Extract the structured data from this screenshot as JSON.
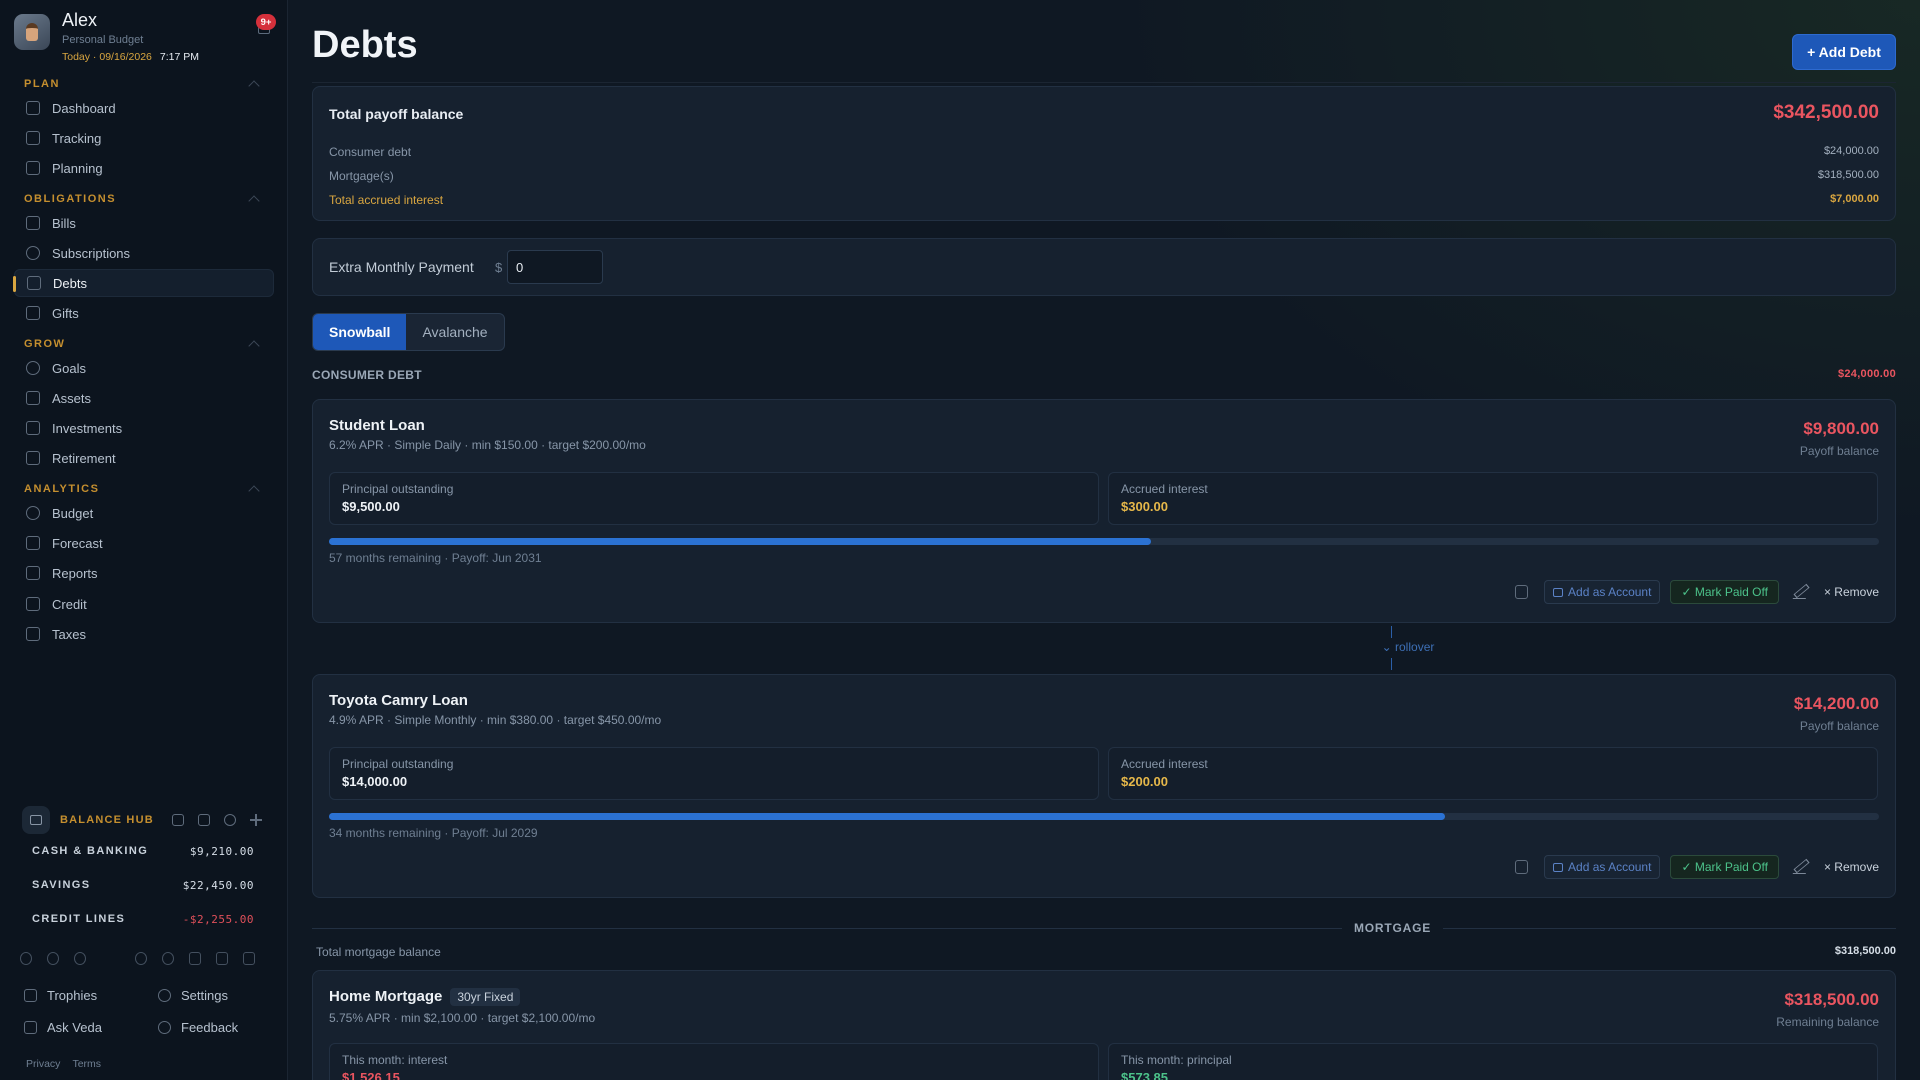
{
  "profile": {
    "name": "Alex",
    "subtitle": "Personal Budget",
    "date": "Today · 09/16/2026",
    "time": "7:17 PM",
    "notifications": "9+"
  },
  "nav": {
    "plan": {
      "title": "PLAN",
      "items": [
        "Dashboard",
        "Tracking",
        "Planning"
      ]
    },
    "obligations": {
      "title": "OBLIGATIONS",
      "items": [
        "Bills",
        "Subscriptions",
        "Debts",
        "Gifts"
      ]
    },
    "grow": {
      "title": "GROW",
      "items": [
        "Goals",
        "Assets",
        "Investments",
        "Retirement"
      ]
    },
    "analytics": {
      "title": "ANALYTICS",
      "items": [
        "Budget",
        "Forecast",
        "Reports",
        "Credit",
        "Taxes"
      ]
    },
    "active": "Debts"
  },
  "hub": {
    "title": "BALANCE HUB",
    "rows": [
      {
        "label": "CASH & BANKING",
        "value": "$9,210.00"
      },
      {
        "label": "SAVINGS",
        "value": "$22,450.00"
      },
      {
        "label": "CREDIT LINES",
        "value": "-$2,255.00"
      }
    ]
  },
  "footer": {
    "trophies": "Trophies",
    "settings": "Settings",
    "ask": "Ask Veda",
    "feedback": "Feedback",
    "privacy": "Privacy",
    "terms": "Terms"
  },
  "page": {
    "title": "Debts",
    "add_button": "+ Add Debt"
  },
  "totals": {
    "title": "Total payoff balance",
    "amount": "$342,500.00",
    "rows": [
      {
        "label": "Consumer debt",
        "value": "$24,000.00"
      },
      {
        "label": "Mortgage(s)",
        "value": "$318,500.00"
      },
      {
        "label": "Total accrued interest",
        "value": "$7,000.00"
      }
    ]
  },
  "extra": {
    "label": "Extra Monthly Payment",
    "currency": "$",
    "value": "0"
  },
  "strategy": {
    "options": [
      "Snowball",
      "Avalanche"
    ],
    "selected": "Snowball"
  },
  "consumer": {
    "title": "CONSUMER DEBT",
    "total": "$24,000.00"
  },
  "debts": [
    {
      "name": "Student Loan",
      "meta": "6.2% APR · Simple Daily · min $150.00 · target $200.00/mo",
      "amount": "$9,800.00",
      "amount_label": "Payoff balance",
      "left_label": "Principal outstanding",
      "left_value": "$9,500.00",
      "right_label": "Accrued interest",
      "right_value": "$300.00",
      "progress": 0.53,
      "remaining": "57 months remaining · Payoff: Jun 2031"
    },
    {
      "name": "Toyota Camry Loan",
      "meta": "4.9% APR · Simple Monthly · min $380.00 · target $450.00/mo",
      "amount": "$14,200.00",
      "amount_label": "Payoff balance",
      "left_label": "Principal outstanding",
      "left_value": "$14,000.00",
      "right_label": "Accrued interest",
      "right_value": "$200.00",
      "progress": 0.72,
      "remaining": "34 months remaining · Payoff: Jul 2029"
    }
  ],
  "actions": {
    "add_account": "Add as Account",
    "mark_paid": "✓ Mark Paid Off",
    "remove": "× Remove"
  },
  "rollover": "rollover",
  "mortgage": {
    "section": "MORTGAGE",
    "total_label": "Total mortgage balance",
    "total": "$318,500.00",
    "name": "Home Mortgage",
    "tag": "30yr Fixed",
    "meta": "5.75% APR · min $2,100.00 · target $2,100.00/mo",
    "amount": "$318,500.00",
    "amount_label": "Remaining balance",
    "left_label": "This month: interest",
    "left_value": "$1,526.15",
    "right_label": "This month: principal",
    "right_value": "$573.85"
  },
  "colors": {
    "accent": "#1e58b8",
    "negative": "#ea5560",
    "gold": "#d9a640",
    "positive": "#4cc28a"
  }
}
